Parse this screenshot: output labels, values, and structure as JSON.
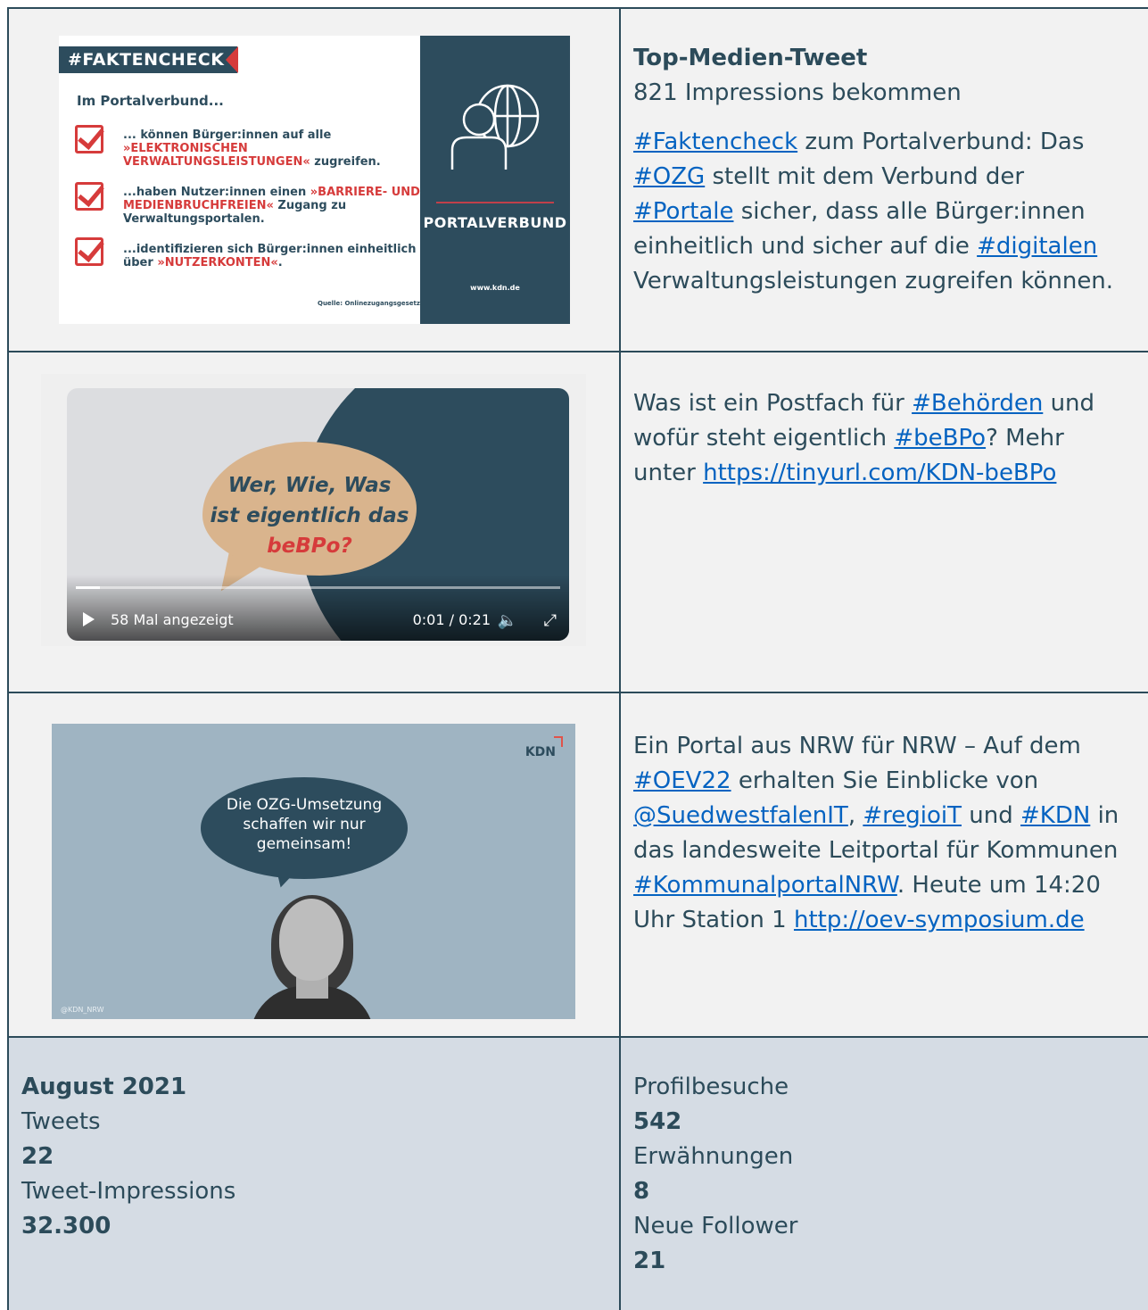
{
  "row1": {
    "image": {
      "banner": "#FAKTENCHECK",
      "subtitle": "Im Portalverbund...",
      "items": [
        {
          "pre": "... können Bürger:innen auf alle ",
          "red": "»ELEKTRONISCHEN",
          "line2red": "VERWALTUNGSLEISTUNGEN«",
          "line2": " zugreifen."
        },
        {
          "pre": "...haben Nutzer:innen einen ",
          "red": "»BARRIERE- UND",
          "line2red": "MEDIENBRUCHFREIEN«",
          "line2": " Zugang zu Verwaltungsportalen."
        },
        {
          "pre": "...identifizieren sich Bürger:innen einheitlich",
          "red": "",
          "line2red": "",
          "line2": "über ",
          "line2red2": "»NUTZERKONTEN«",
          "line2end": "."
        }
      ],
      "source": "Quelle: Onlinezugangsgesetz",
      "panel_label": "PORTALVERBUND",
      "panel_url": "www.kdn.de"
    },
    "title": "Top-Medien-Tweet",
    "impressions": "821 Impressions bekommen",
    "text": {
      "t1": "#Faktencheck",
      "t2": " zum Portalverbund: Das ",
      "t3": "#OZG",
      "t4": " stellt mit dem Verbund der ",
      "t5": "#Portale",
      "t6": " sicher, dass alle Bürger:innen einheitlich und sicher auf die ",
      "t7": "#digitalen",
      "t8": " Verwaltungsleistungen zugreifen können."
    }
  },
  "row2": {
    "video": {
      "bubble_line1": "Wer, Wie, Was",
      "bubble_line2": "ist eigentlich das",
      "bubble_line3": "beBPo?",
      "views": "58 Mal angezeigt",
      "time": "0:01 / 0:21",
      "progress": 0.05
    },
    "text": {
      "t1": "Was ist ein Postfach für ",
      "t2": "#Behörden",
      "t3": " und wofür steht eigentlich ",
      "t4": "#beBPo",
      "t5": "? Mehr unter ",
      "t6": "https://tinyurl.com/KDN-beBPo"
    }
  },
  "row3": {
    "image": {
      "logo": "KDN",
      "speech_line1": "Die OZG-Umsetzung",
      "speech_line2": "schaffen wir nur",
      "speech_line3": "gemeinsam!",
      "handle": "@KDN_NRW"
    },
    "text": {
      "t1": "Ein Portal aus NRW für NRW – Auf dem ",
      "t2": "#OEV22",
      "t3": " erhalten Sie Einblicke von ",
      "t4": "@SuedwestfalenIT",
      "t5": ", ",
      "t6": "#regioiT",
      "t7": " und ",
      "t8": "#KDN",
      "t9": " in das landesweite Leitportal für Kommunen ",
      "t10": "#KommunalportalNRW",
      "t11": ". Heute um 14:20 Uhr Station 1 ",
      "t12": "http://oev-symposium.de"
    }
  },
  "stats": {
    "month": "August 2021",
    "tweets_label": "Tweets",
    "tweets_value": "22",
    "impr_label": "Tweet-Impressions",
    "impr_value": "32.300",
    "visits_label": "Profilbesuche",
    "visits_value": "542",
    "mentions_label": "Erwähnungen",
    "mentions_value": "8",
    "followers_label": "Neue Follower",
    "followers_value": "21"
  },
  "colors": {
    "border": "#2c4b5a",
    "link": "#0563c1",
    "stats_bg": "#d5dce4",
    "accent_red": "#d63b3b"
  }
}
